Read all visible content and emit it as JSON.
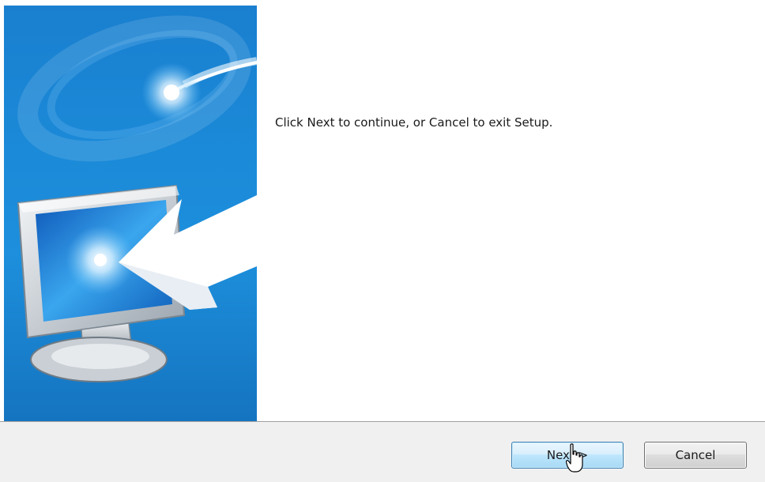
{
  "wizard": {
    "message": "Click Next to continue, or Cancel to exit Setup.",
    "next_label": "Next >",
    "cancel_label": "Cancel"
  },
  "banner": {
    "illustration": "monitor-with-arrow",
    "colors": {
      "background": "#1b8ad8",
      "accent": "#ffffff"
    }
  },
  "cursor": {
    "icon": "hand-pointer-icon"
  }
}
